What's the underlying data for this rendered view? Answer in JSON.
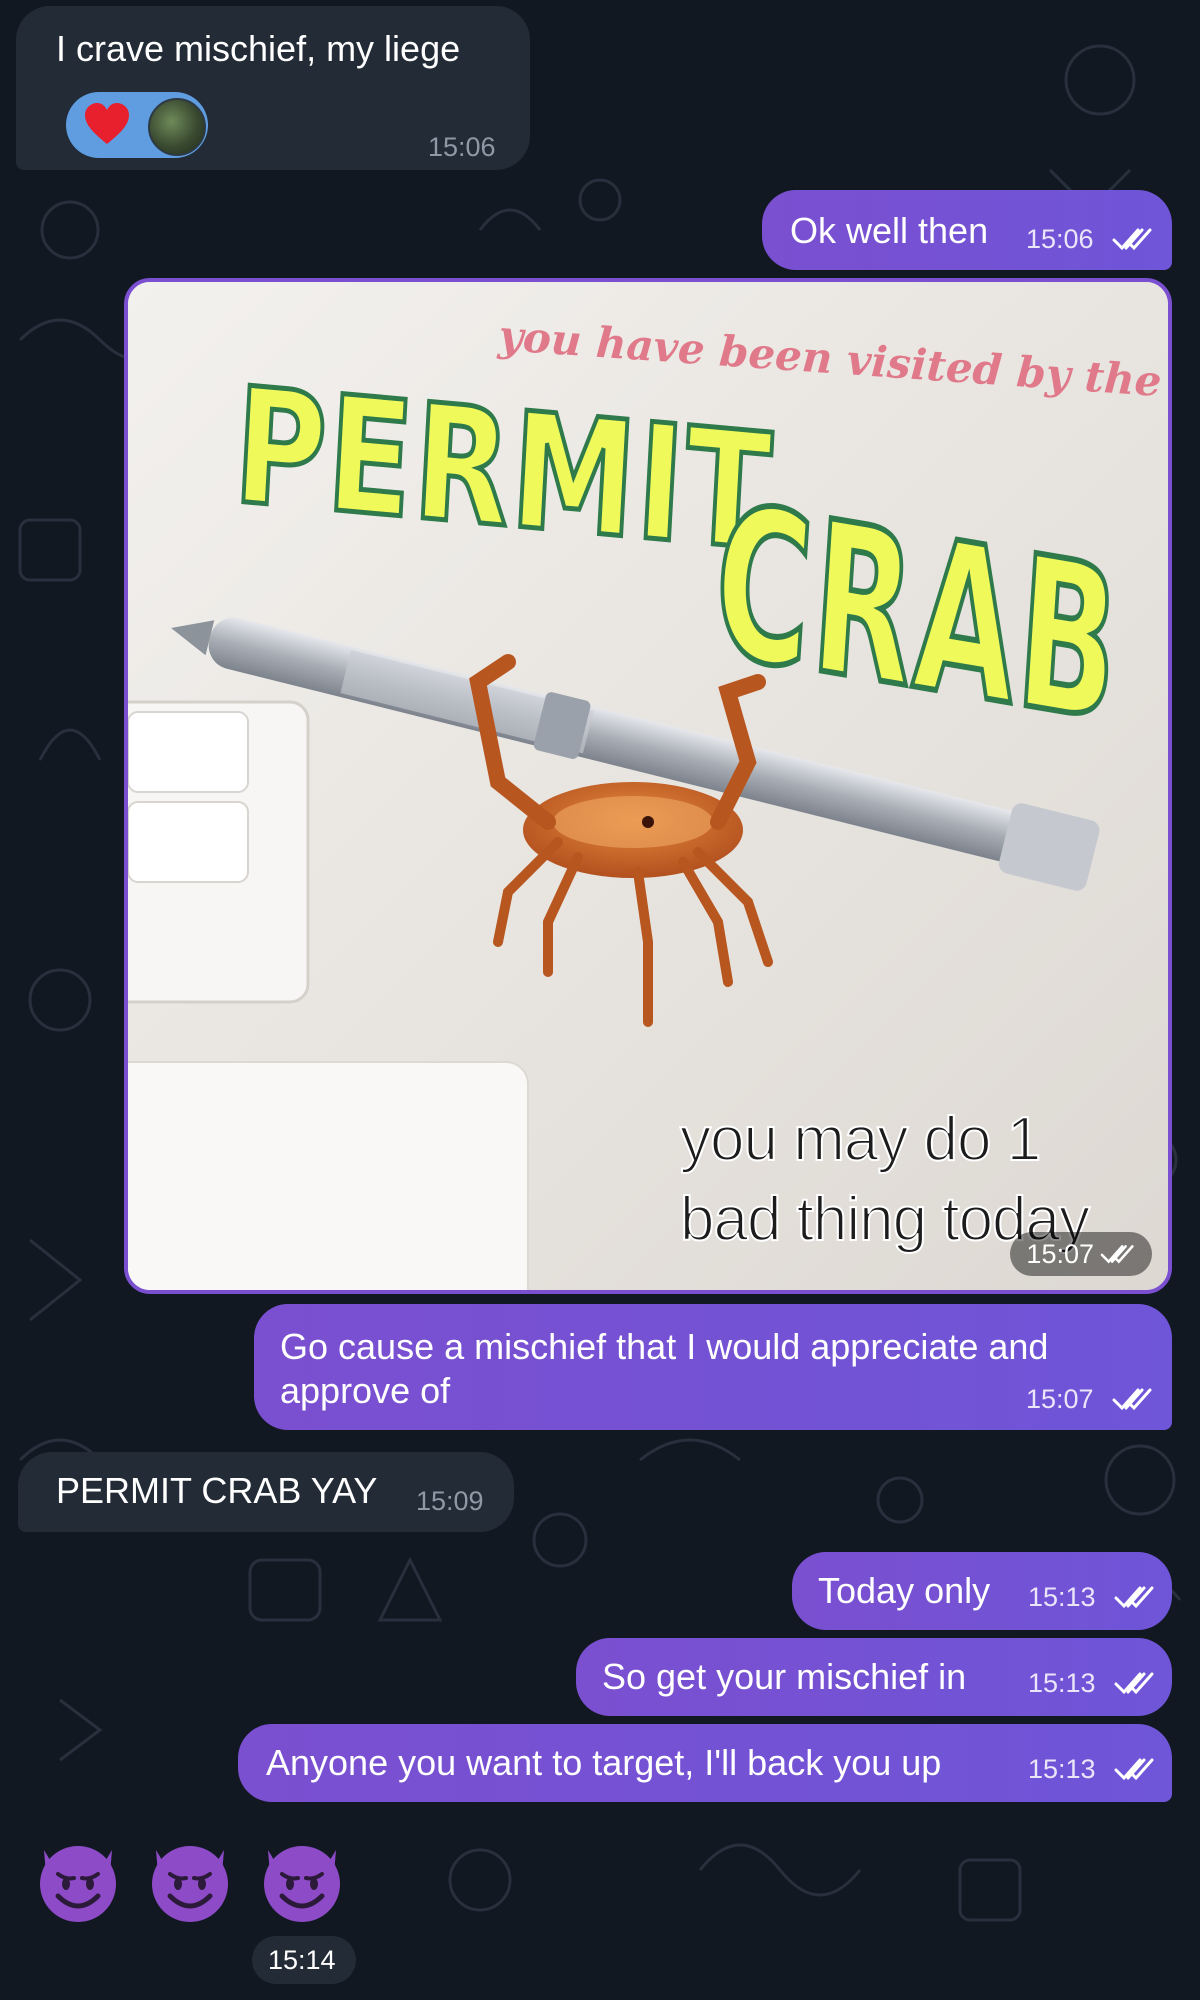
{
  "messages": {
    "m1": {
      "text": "I crave mischief, my liege",
      "time": "15:06",
      "reactions": [
        "red-heart-icon",
        "avatar-icon"
      ]
    },
    "m2": {
      "text": "Ok well then",
      "time": "15:06"
    },
    "m3": {
      "time": "15:07",
      "image": {
        "caption_top": "you have been visited by the",
        "title_line1": "PERMIT",
        "title_line2": "CRAB",
        "caption_bottom_1": "you may do 1",
        "caption_bottom_2": "bad thing today"
      }
    },
    "m4": {
      "line1": "Go cause a mischief that I would appreciate and",
      "line2": "approve of",
      "time": "15:07"
    },
    "m5": {
      "text": "PERMIT CRAB YAY",
      "time": "15:09"
    },
    "m6": {
      "text": "Today only",
      "time": "15:13"
    },
    "m7": {
      "text": "So get your mischief in",
      "time": "15:13"
    },
    "m8": {
      "text": "Anyone you want to target, I'll back you up",
      "time": "15:13"
    },
    "m9": {
      "emojis": [
        "smiling-devil-icon",
        "smiling-devil-icon",
        "smiling-devil-icon"
      ],
      "time": "15:14"
    }
  },
  "colors": {
    "background": "#111822",
    "incoming_bubble": "#222b36",
    "outgoing_bubble": "#7a4fd0",
    "reaction_pill": "#5f9de0"
  }
}
